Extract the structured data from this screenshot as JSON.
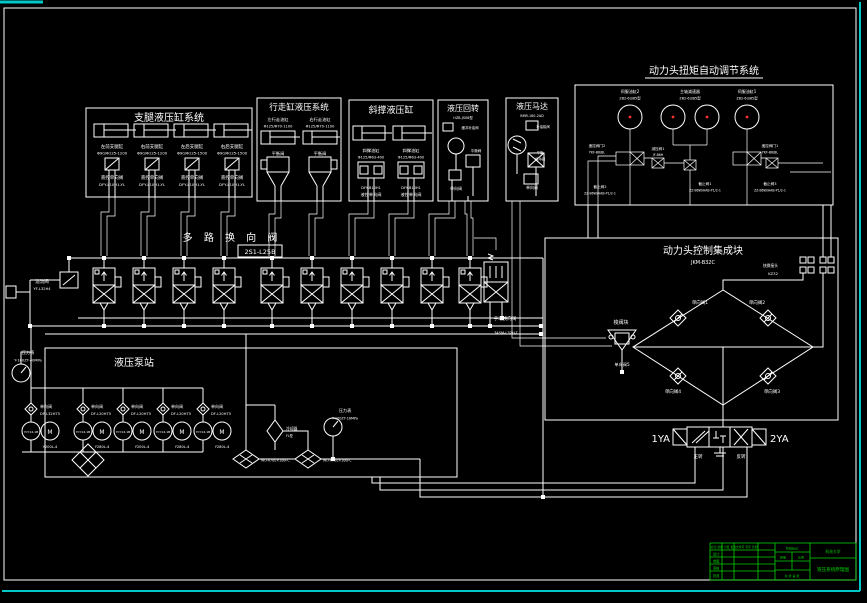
{
  "colors": {
    "background": "#000000",
    "line": "#ffffff",
    "title_block_green": "#00d400",
    "frame_cyan": "#00c8c8",
    "gauge_dot_red": "#ff3030"
  },
  "legs": {
    "title": "支腿液压缸系统",
    "units": [
      {
        "name": "左前支腿缸",
        "spec": "Φ90/Φ125-1200",
        "valve": "液控单向阀",
        "model": "DFY-L10H1-YL"
      },
      {
        "name": "右前支腿缸",
        "spec": "Φ90/Φ125-1200",
        "valve": "液控单向阀",
        "model": "DFY-L10H1-YL"
      },
      {
        "name": "左后支腿缸",
        "spec": "Φ90/Φ125-1500",
        "valve": "液控单向阀",
        "model": "DFY-L10H1-YL"
      },
      {
        "name": "右后支腿缸",
        "spec": "Φ90/Φ125-1500",
        "valve": "液控单向阀",
        "model": "DFY-L10H1-YL"
      }
    ]
  },
  "travel": {
    "title": "行走缸液压系统",
    "units": [
      {
        "name": "左行走油缸",
        "spec": "Φ125/Φ70-1100",
        "valve": "平衡阀"
      },
      {
        "name": "右行走油缸",
        "spec": "Φ125/Φ70-1100",
        "valve": "平衡阀"
      }
    ]
  },
  "brace": {
    "title": "斜撑液压缸",
    "units": [
      {
        "name": "斜撑油缸",
        "spec": "Φ125/Φ63-400",
        "model": "DFY-B10H1",
        "valve": "液控单向阀"
      },
      {
        "name": "斜撑油缸",
        "spec": "Φ125/Φ63-400",
        "model": "DFY-B10H1",
        "valve": "液控单向阀"
      }
    ]
  },
  "rotary": {
    "title": "液压回转",
    "model": "HZB-JS08型",
    "l1": "缓冲补油阀",
    "l2": "平衡阀",
    "l3": "单向阀"
  },
  "motor": {
    "title": "液压马达",
    "model": "BMR-160-2AD",
    "l1": "补油梭阀",
    "l2": "平衡",
    "l3": "缓冲阀",
    "l4": "单向阀"
  },
  "torque": {
    "title": "动力头扭矩自动调节系统",
    "gauges": [
      {
        "name": "伺服油缸2",
        "model": "ZB2-63/85型"
      },
      {
        "name": "主轴减速器",
        "model": "ZB2-63/85型"
      },
      {
        "name": "伺服油缸1",
        "model": "ZB2-63/85型"
      }
    ],
    "valves": [
      {
        "name": "遥控阀门2",
        "model": "YKF-B6/BL"
      },
      {
        "name": "减压阀1",
        "model": "JF-B6H"
      },
      {
        "name": "遥控阀门1",
        "model": "YKF-B6/BL"
      },
      {
        "name": "截止阀2",
        "model": "ZZ-B6W/AAB-P1/2-1"
      },
      {
        "name": "截止阀1",
        "model": "ZZ-B6W/AAB-P1/2-1"
      },
      {
        "name": "截止阀3",
        "model": "ZZ-B6W/AAB-P1/2-1"
      }
    ]
  },
  "manifold": {
    "title": "多 路 换 向 阀",
    "model": "2S1-L25B"
  },
  "relief": {
    "name": "溢流阀",
    "model": "YF-L32H4"
  },
  "manual_valve": {
    "name": "手动换向阀",
    "model": "34SM-L32H-T"
  },
  "block": {
    "title": "动力头控制集成块",
    "model": "JKM-B32C",
    "coupling_name": "快换接头",
    "coupling_model": "KZ32",
    "cv1": "单向阀1",
    "cv2": "单向阀2",
    "cv3": "单向阀3",
    "cv4": "单向阀4",
    "cv5": "单向阀5",
    "shuttle": "梭阀块",
    "ya1": "1YA",
    "ya2": "2YA",
    "fwd": "正转",
    "rev": "反转"
  },
  "pump": {
    "title": "液压泵站",
    "gauge1_name": "压力表",
    "gauge1_model": "Y-100ZT-40MPa",
    "gauge2_name": "压力表",
    "gauge2_model": "Y-100ZT-16MPa",
    "g1": {
      "check": "单向阀",
      "check_model": "DF-L32H75",
      "pump": "YCY14-1B",
      "m": "M",
      "motor_model": "Y200L-4"
    },
    "groups": [
      {
        "check": "单向阀",
        "check_model": "DF-L20H75",
        "pump": "YCY14-1B",
        "m": "M",
        "motor_model": "Y280L-4"
      },
      {
        "check": "单向阀",
        "check_model": "DF-L20H75",
        "pump": "YCY14-1B",
        "m": "M",
        "motor_model": "Y200L-4"
      },
      {
        "check": "单向阀",
        "check_model": "DF-L20H75",
        "pump": "YCY14-1B",
        "m": "M",
        "motor_model": "Y280L-4"
      },
      {
        "check": "单向阀",
        "check_model": "DF-L20H75",
        "pump": "YCY14-1B",
        "m": "M",
        "motor_model": "Y280L-4"
      }
    ],
    "cooler_name": "冷却器",
    "cooler_model": "FL型",
    "filter1": "WU-A700×100FC",
    "filter2": "WU-A700×100FC"
  },
  "title_block": {
    "rev_header": "标记 处数 分区 更改文件号 签字 日期",
    "r1": "设计",
    "r2": "制图",
    "r3": "审核",
    "r4": "批准",
    "stage": "阶段标记",
    "mass": "质量",
    "scale": "比例",
    "sheets": "共 张 第 张",
    "org": "科技大学",
    "drawing": "液压系统原理图"
  }
}
